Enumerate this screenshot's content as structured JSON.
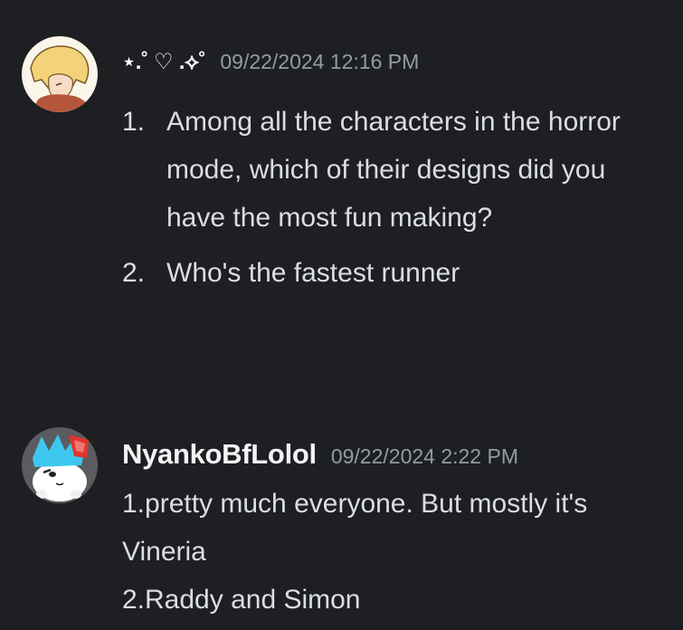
{
  "messages": [
    {
      "username": "⋆.˚ ♡ .⟡˚",
      "timestamp": "09/22/2024 12:16 PM",
      "avatar_icon": "cartoon-blonde-character-avatar",
      "list_items": [
        {
          "number": "1.",
          "text": "Among all the characters in the horror mode, which of their designs did you have the most fun making?"
        },
        {
          "number": "2.",
          "text": "Who's the fastest runner"
        }
      ]
    },
    {
      "username": "NyankoBfLolol",
      "timestamp": "09/22/2024 2:22 PM",
      "avatar_icon": "white-cat-blue-hair-avatar",
      "lines": [
        "1.pretty much everyone. But mostly it's Vineria",
        "2.Raddy and Simon"
      ]
    }
  ],
  "colors": {
    "background": "#1e1f22",
    "username": "#f2f3f5",
    "timestamp": "#949ba4",
    "text": "#dbdee1"
  }
}
